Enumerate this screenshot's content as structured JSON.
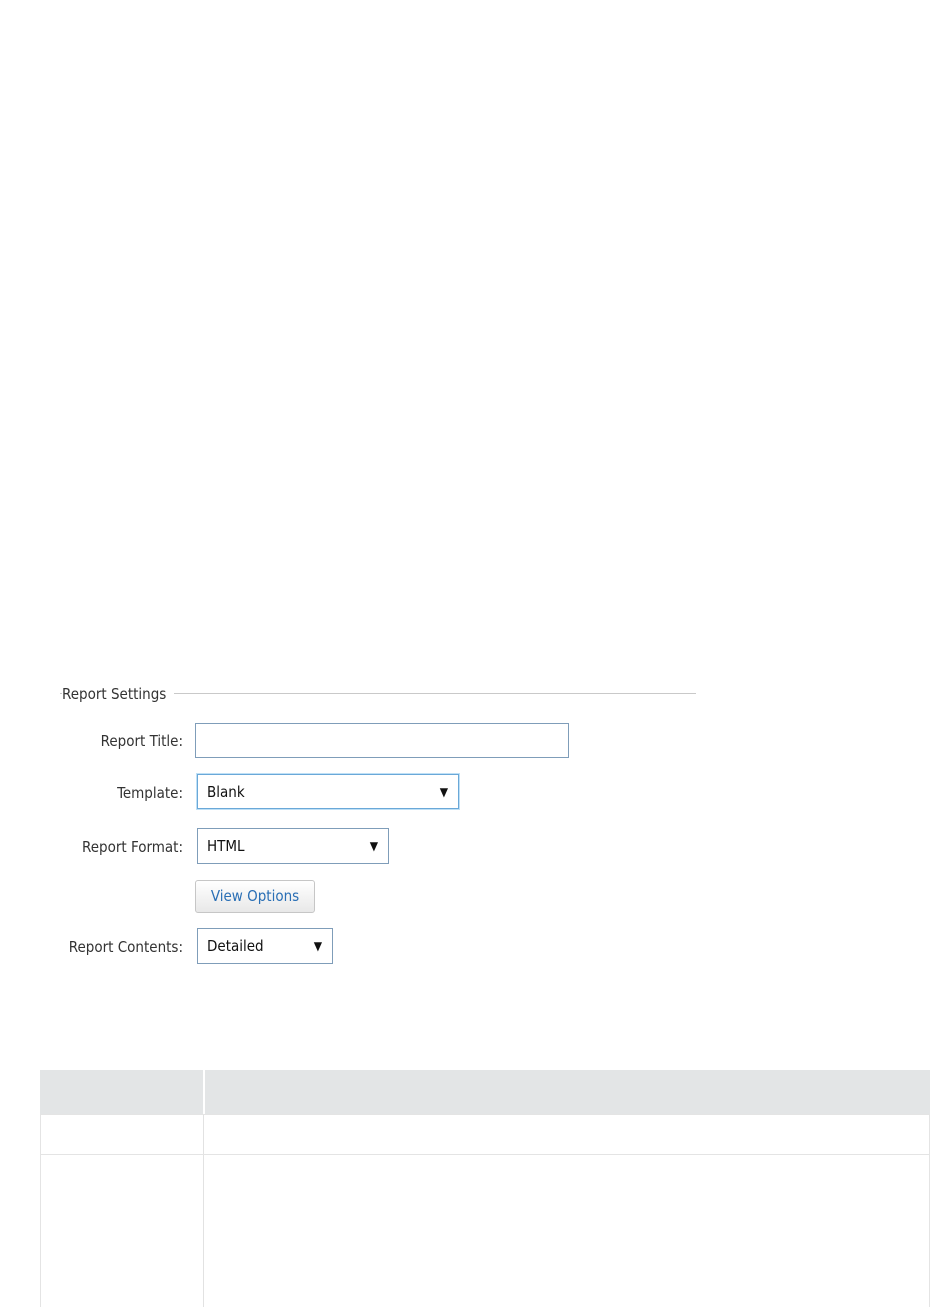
{
  "report_settings": {
    "legend": "Report Settings",
    "title_label": "Report Title:",
    "title_value": "",
    "template_label": "Template:",
    "template_value": "Blank",
    "format_label": "Report Format:",
    "format_value": "HTML",
    "view_options_label": "View Options",
    "contents_label": "Report Contents:",
    "contents_value": "Detailed"
  },
  "icons": {
    "dropdown_arrow": "caret-down-icon",
    "dropdown_arrow_glyph": "▼"
  },
  "colors": {
    "link_blue": "#2a6fb5",
    "table_header_bg": "#e3e5e6",
    "input_border": "#7f9db9",
    "focus_border": "#6aa8d8"
  }
}
